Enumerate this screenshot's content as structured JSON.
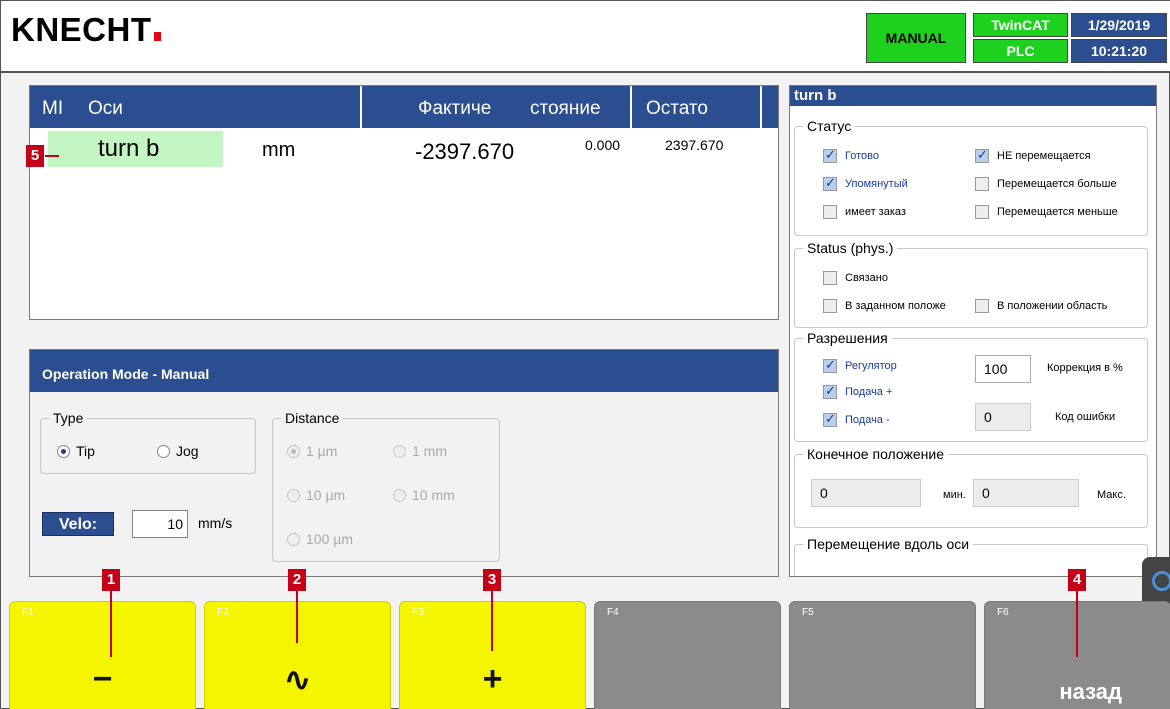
{
  "header": {
    "logo": "KNECHT",
    "mode": "MANUAL",
    "twincat": "TwinCAT",
    "plc": "PLC",
    "date": "1/29/2019",
    "time": "10:21:20"
  },
  "axis_table": {
    "columns": [
      "MI",
      "Оси",
      "Фактиче",
      "стояние",
      "Остато"
    ],
    "row": {
      "name": "turn b",
      "unit": "mm",
      "actual": "-2397.670",
      "setpoint": "0.000",
      "remaining": "2397.670"
    }
  },
  "operation": {
    "title": "Operation Mode - Manual",
    "type_title": "Type",
    "type_options": [
      {
        "label": "Tip",
        "selected": true
      },
      {
        "label": "Jog",
        "selected": false
      }
    ],
    "distance_title": "Distance",
    "distance_options": [
      {
        "label": "1 µm",
        "selected": true
      },
      {
        "label": "1 mm",
        "selected": false
      },
      {
        "label": "10 µm",
        "selected": false
      },
      {
        "label": "10 mm",
        "selected": false
      },
      {
        "label": "100 µm",
        "selected": false
      }
    ],
    "velo_label": "Velo:",
    "velo_value": "10",
    "velo_unit": "mm/s"
  },
  "status_panel": {
    "title": "turn b",
    "status": {
      "title": "Статус",
      "items": [
        {
          "label": "Готово",
          "checked": true
        },
        {
          "label": "НЕ перемещается",
          "checked": true
        },
        {
          "label": "Упомянутый",
          "checked": true
        },
        {
          "label": "Перемещается больше",
          "checked": false
        },
        {
          "label": "имеет заказ",
          "checked": false
        },
        {
          "label": "Перемещается меньше",
          "checked": false
        }
      ]
    },
    "phys": {
      "title": "Status (phys.)",
      "items": [
        {
          "label": "Связано",
          "checked": false
        },
        {
          "label": "В заданном положе",
          "checked": false
        },
        {
          "label": "В положении область",
          "checked": false
        }
      ]
    },
    "permissions": {
      "title": "Разрешения",
      "items": [
        {
          "label": "Регулятор",
          "checked": true
        },
        {
          "label": "Подача +",
          "checked": true
        },
        {
          "label": "Подача -",
          "checked": true
        }
      ],
      "override_value": "100",
      "override_label": "Коррекция в %",
      "error_value": "0",
      "error_label": "Код ошибки"
    },
    "end_position": {
      "title": "Конечное положение",
      "min_value": "0",
      "min_label": "мин.",
      "max_value": "0",
      "max_label": "Макс."
    },
    "move_along": {
      "title": "Перемещение вдоль оси"
    }
  },
  "function_keys": [
    {
      "id": "F1",
      "symbol": "−",
      "color": "#f5f500"
    },
    {
      "id": "F2",
      "symbol": "∿",
      "color": "#f5f500"
    },
    {
      "id": "F3",
      "symbol": "+",
      "color": "#f5f500"
    },
    {
      "id": "F4",
      "symbol": "",
      "color": "#8b8b8b"
    },
    {
      "id": "F5",
      "symbol": "",
      "color": "#8b8b8b"
    },
    {
      "id": "F6",
      "symbol": "назад",
      "color": "#8b8b8b"
    }
  ],
  "callouts": [
    "1",
    "2",
    "3",
    "4",
    "5"
  ],
  "colors": {
    "accent": "#2a4e8f",
    "status_green": "#1fd11f",
    "fkey_yellow": "#f5f500",
    "callout_red": "#c40018"
  }
}
